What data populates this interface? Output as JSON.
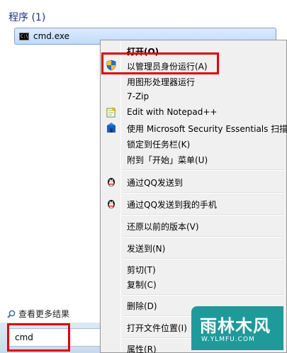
{
  "start_menu": {
    "programs_header": "程序 (1)",
    "program": {
      "name": "cmd.exe",
      "icon": "cmd-icon"
    },
    "see_more": "查看更多结果",
    "search": {
      "value": "cmd"
    }
  },
  "context_menu": {
    "items": [
      {
        "label": "打开(O)",
        "bold": true,
        "icon": ""
      },
      {
        "label": "以管理员身份运行(A)",
        "icon": "uac-shield-icon"
      },
      {
        "label": "用图形处理器运行",
        "icon": ""
      },
      {
        "label": "7-Zip",
        "icon": ""
      },
      {
        "label": "Edit with Notepad++",
        "icon": "notepad-plus-plus-icon"
      },
      {
        "label": "使用 Microsoft Security Essentials 扫描...",
        "icon": "mse-icon"
      },
      {
        "label": "锁定到任务栏(K)",
        "icon": ""
      },
      {
        "label": "附到「开始」菜单(U)",
        "icon": ""
      },
      {
        "label": "通过QQ发送到",
        "icon": "qq-penguin-icon"
      },
      {
        "label": "通过QQ发送到我的手机",
        "icon": "qq-penguin-icon"
      },
      {
        "label": "还原以前的版本(V)",
        "icon": ""
      },
      {
        "label": "发送到(N)",
        "icon": ""
      },
      {
        "label": "剪切(T)",
        "icon": ""
      },
      {
        "label": "复制(C)",
        "icon": ""
      },
      {
        "label": "删除(D)",
        "icon": ""
      },
      {
        "label": "打开文件位置(I)",
        "icon": ""
      },
      {
        "label": "属性(R)",
        "icon": ""
      }
    ]
  },
  "watermark": {
    "main": "雨林木风",
    "sub": "W.YLMFU.COM"
  },
  "colors": {
    "highlight_box": "#e00000",
    "header_text": "#1e3287",
    "watermark_bg": "#1f9a9a"
  }
}
